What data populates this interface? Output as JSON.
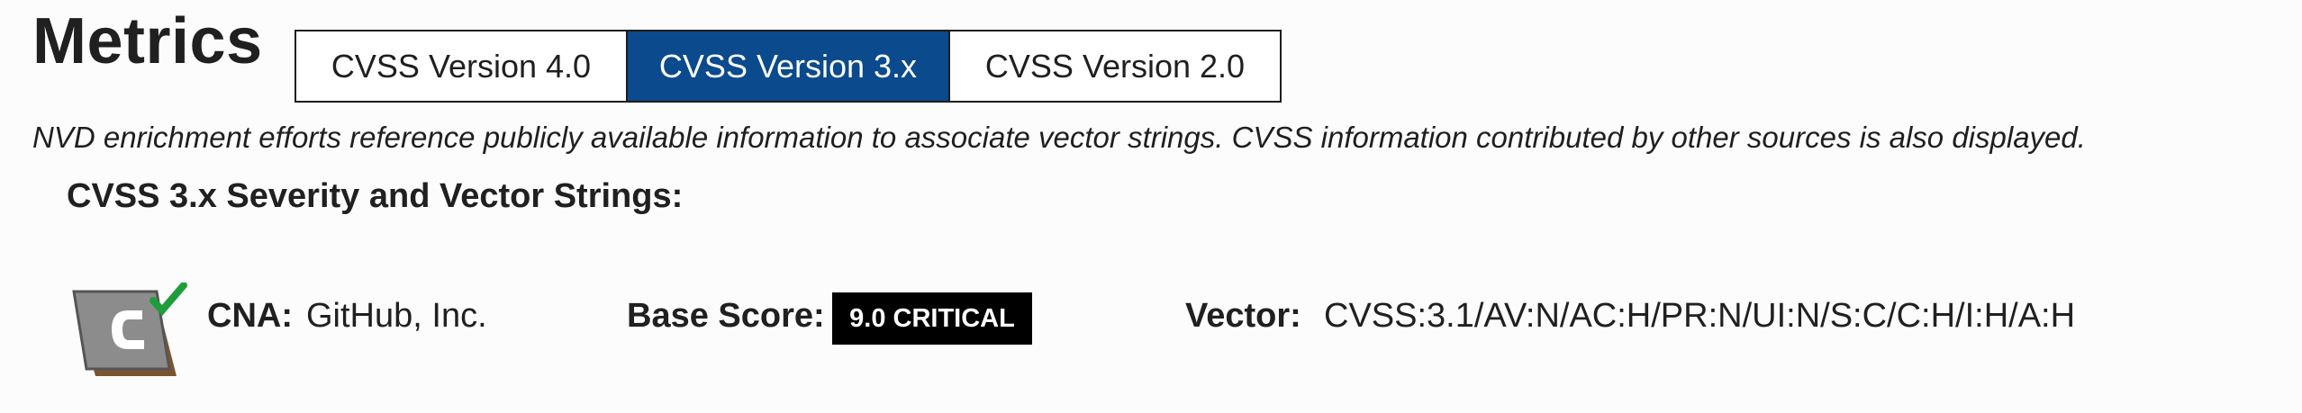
{
  "page": {
    "title": "Metrics",
    "note": "NVD enrichment efforts reference publicly available information to associate vector strings. CVSS information contributed by other sources is also displayed."
  },
  "tabs": [
    {
      "label": "CVSS Version 4.0",
      "active": false
    },
    {
      "label": "CVSS Version 3.x",
      "active": true
    },
    {
      "label": "CVSS Version 2.0",
      "active": false
    }
  ],
  "section": {
    "heading": "CVSS 3.x Severity and Vector Strings:"
  },
  "cna": {
    "label": "CNA:",
    "value": "GitHub, Inc.",
    "icon": "cna-check-icon"
  },
  "base_score": {
    "label": "Base Score:",
    "value": "9.0 CRITICAL",
    "badge_color": "#000000"
  },
  "vector": {
    "label": "Vector:",
    "value": "CVSS:3.1/AV:N/AC:H/PR:N/UI:N/S:C/C:H/I:H/A:H"
  },
  "colors": {
    "active_tab": "#0b4a8c",
    "check": "#1f9d3a",
    "logo_brown": "#7a5530",
    "logo_gray": "#8c8c8c"
  }
}
